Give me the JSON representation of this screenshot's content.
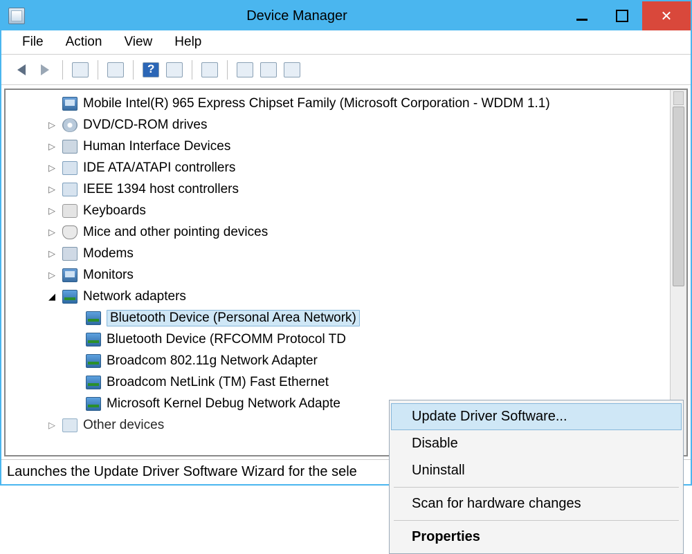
{
  "title": "Device Manager",
  "menu": {
    "file": "File",
    "action": "Action",
    "view": "View",
    "help": "Help"
  },
  "tree": {
    "item_chipset": "Mobile Intel(R) 965 Express Chipset Family (Microsoft Corporation - WDDM 1.1)",
    "item_dvd": "DVD/CD-ROM drives",
    "item_hid": "Human Interface Devices",
    "item_ide": "IDE ATA/ATAPI controllers",
    "item_1394": "IEEE 1394 host controllers",
    "item_kbd": "Keyboards",
    "item_mouse": "Mice and other pointing devices",
    "item_modem": "Modems",
    "item_monitor": "Monitors",
    "item_net": "Network adapters",
    "net_children": {
      "bt_pan": "Bluetooth Device (Personal Area Network)",
      "bt_rfcomm_partial": "Bluetooth Device (RFCOMM Protocol TD",
      "broadcom_wifi": "Broadcom 802.11g Network Adapter",
      "broadcom_eth": "Broadcom NetLink (TM) Fast Ethernet",
      "ms_kernel_partial": "Microsoft Kernel Debug Network Adapte"
    },
    "item_other_partial": "Other devices"
  },
  "context_menu": {
    "update": "Update Driver Software...",
    "disable": "Disable",
    "uninstall": "Uninstall",
    "scan": "Scan for hardware changes",
    "properties": "Properties"
  },
  "statusbar_partial": "Launches the Update Driver Software Wizard for the sele"
}
